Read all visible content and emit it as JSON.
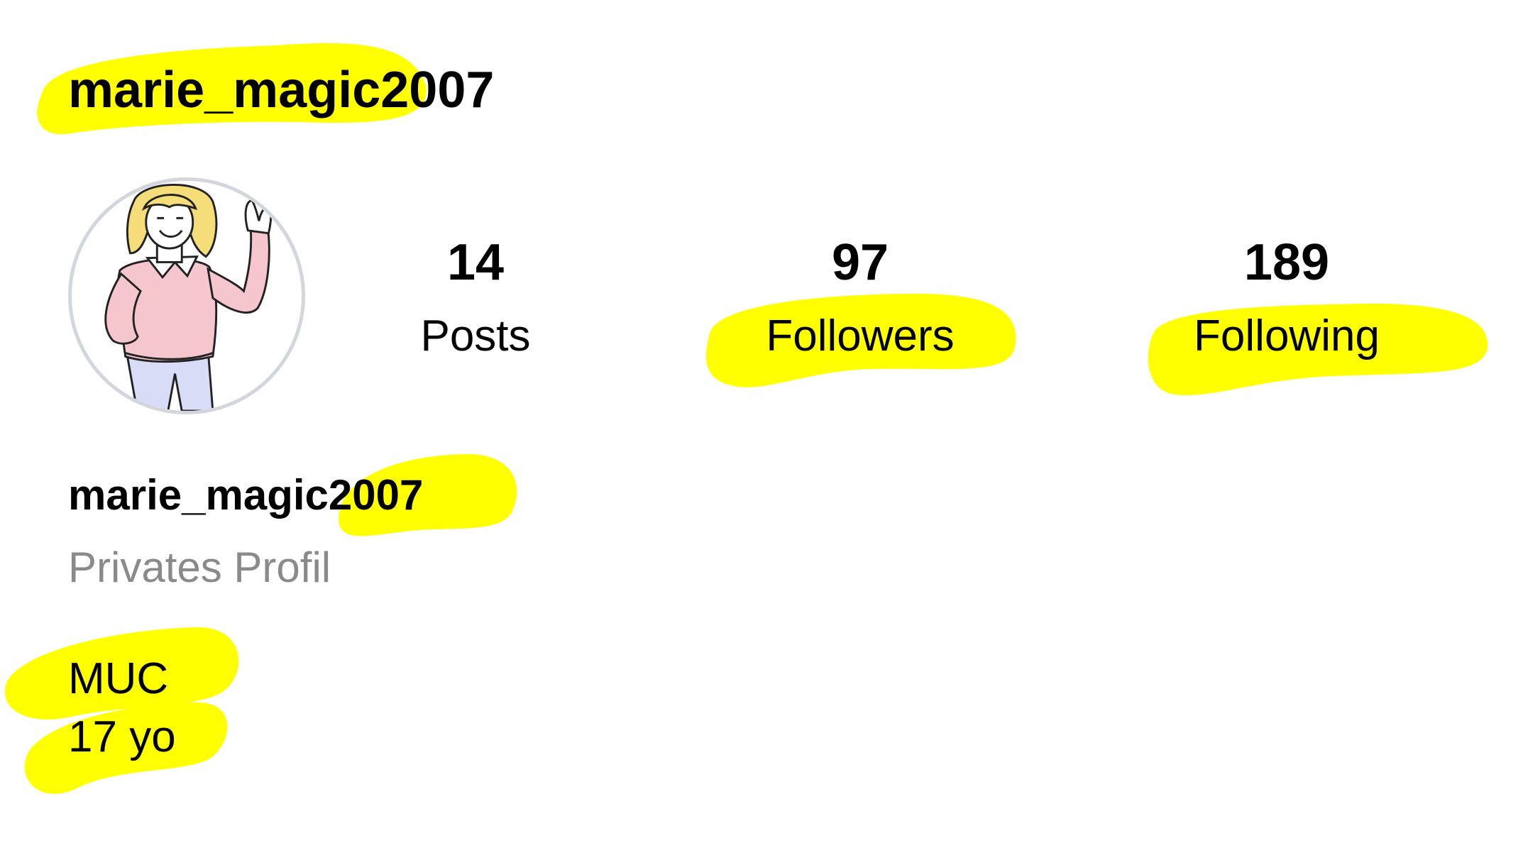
{
  "header": {
    "username": "marie_magic2007"
  },
  "avatar": {
    "icon": "illustrated-person-waving",
    "border_color": "#d3d6dd"
  },
  "stats": [
    {
      "value": "14",
      "label": "Posts"
    },
    {
      "value": "97",
      "label": "Followers"
    },
    {
      "value": "189",
      "label": "Following"
    }
  ],
  "profile": {
    "name": "marie_magic2007",
    "privacy": "Privates Profil"
  },
  "bio": {
    "lines": [
      "MUC",
      "17 yo"
    ]
  },
  "colors": {
    "highlight": "#ffff00",
    "muted_text": "#8a8a8a",
    "text": "#000000"
  }
}
